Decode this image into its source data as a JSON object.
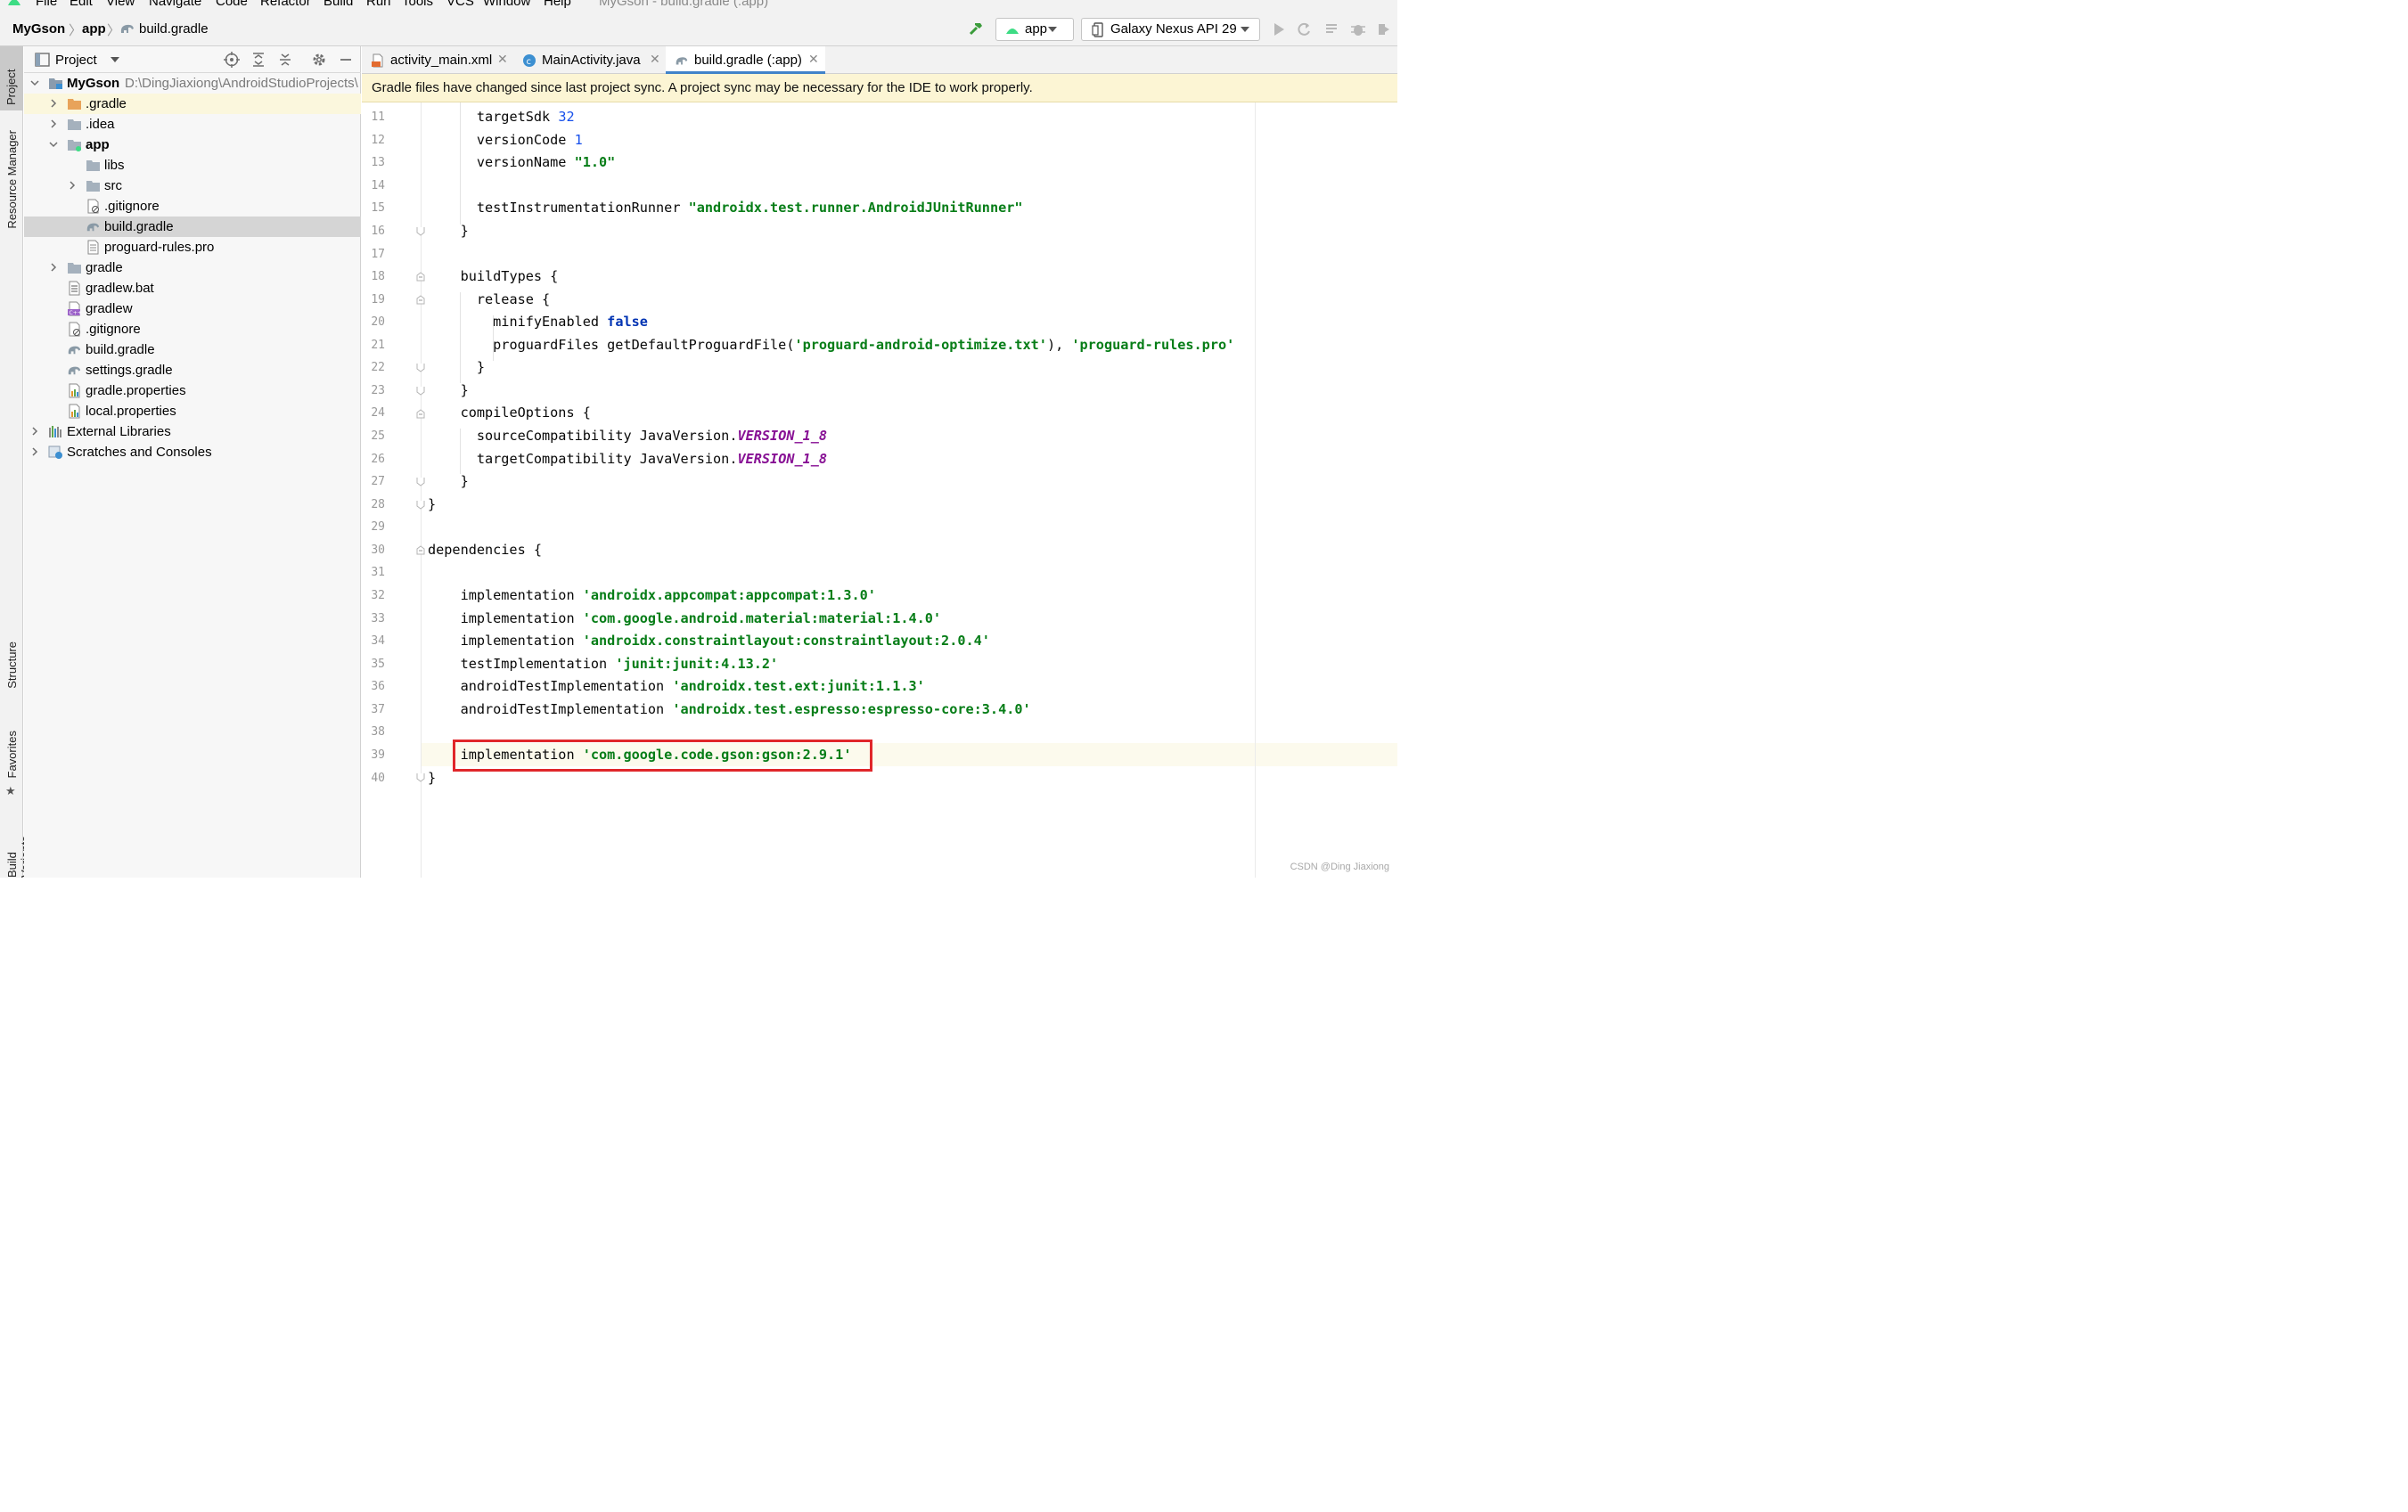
{
  "menu": {
    "items": [
      "File",
      "Edit",
      "View",
      "Navigate",
      "Code",
      "Refactor",
      "Build",
      "Run",
      "Tools",
      "VCS",
      "Window",
      "Help"
    ],
    "window_title": "MyGson - build.gradle (:app)"
  },
  "breadcrumb": {
    "project": "MyGson",
    "module": "app",
    "file": "build.gradle"
  },
  "toolbar": {
    "run_config": "app",
    "device": "Galaxy Nexus API 29"
  },
  "left_strip": {
    "tabs": [
      "Project",
      "Resource Manager",
      "Structure",
      "Favorites",
      "Build Variants"
    ]
  },
  "project_panel": {
    "title": "Project",
    "root": {
      "name": "MyGson",
      "path": "D:\\DingJiaxiong\\AndroidStudioProjects\\"
    },
    "items": [
      {
        "label": ".gradle",
        "icon": "folder-orange-icon"
      },
      {
        "label": ".idea",
        "icon": "folder-icon"
      },
      {
        "label": "app",
        "icon": "module-folder-icon"
      },
      {
        "label": "libs",
        "icon": "folder-icon"
      },
      {
        "label": "src",
        "icon": "folder-icon"
      },
      {
        "label": ".gitignore",
        "icon": "gitignore-file-icon"
      },
      {
        "label": "build.gradle",
        "icon": "gradle-elephant-icon"
      },
      {
        "label": "proguard-rules.pro",
        "icon": "text-file-icon"
      },
      {
        "label": "gradle",
        "icon": "folder-icon"
      },
      {
        "label": "gradlew.bat",
        "icon": "bat-file-icon"
      },
      {
        "label": "gradlew",
        "icon": "script-file-icon"
      },
      {
        "label": ".gitignore",
        "icon": "gitignore-file-icon"
      },
      {
        "label": "build.gradle",
        "icon": "gradle-elephant-icon"
      },
      {
        "label": "settings.gradle",
        "icon": "gradle-elephant-icon"
      },
      {
        "label": "gradle.properties",
        "icon": "properties-file-icon"
      },
      {
        "label": "local.properties",
        "icon": "properties-file-icon"
      },
      {
        "label": "External Libraries",
        "icon": "libraries-icon"
      },
      {
        "label": "Scratches and Consoles",
        "icon": "scratches-icon"
      }
    ]
  },
  "tabs": [
    {
      "label": "activity_main.xml",
      "icon": "xml-file-icon"
    },
    {
      "label": "MainActivity.java",
      "icon": "java-class-icon"
    },
    {
      "label": "build.gradle (:app)",
      "icon": "gradle-elephant-icon"
    }
  ],
  "notification": "Gradle files have changed since last project sync. A project sync may be necessary for the IDE to work properly.",
  "editor": {
    "line_numbers": [
      "11",
      "12",
      "13",
      "14",
      "15",
      "16",
      "17",
      "18",
      "19",
      "20",
      "21",
      "22",
      "23",
      "24",
      "25",
      "26",
      "27",
      "28",
      "29",
      "30",
      "31",
      "32",
      "33",
      "34",
      "35",
      "36",
      "37",
      "38",
      "39",
      "40"
    ],
    "code": {
      "l11": [
        "targetSdk ",
        "32"
      ],
      "l12": [
        "versionCode ",
        "1"
      ],
      "l13": [
        "versionName ",
        "\"1.0\""
      ],
      "l15": [
        "testInstrumentationRunner ",
        "\"androidx.test.runner.AndroidJUnitRunner\""
      ],
      "l16": "}",
      "l18": "buildTypes {",
      "l19": "release {",
      "l20": [
        "minifyEnabled ",
        "false"
      ],
      "l21": [
        "proguardFiles getDefaultProguardFile(",
        "'proguard-android-optimize.txt'",
        "), ",
        "'proguard-rules.pro'"
      ],
      "l22": "}",
      "l23": "}",
      "l24": "compileOptions {",
      "l25": [
        "sourceCompatibility JavaVersion.",
        "VERSION_1_8"
      ],
      "l26": [
        "targetCompatibility JavaVersion.",
        "VERSION_1_8"
      ],
      "l27": "}",
      "l28": "}",
      "l30": "dependencies {",
      "l32": [
        "implementation ",
        "'androidx.appcompat:appcompat:1.3.0'"
      ],
      "l33": [
        "implementation ",
        "'com.google.android.material:material:1.4.0'"
      ],
      "l34": [
        "implementation ",
        "'androidx.constraintlayout:constraintlayout:2.0.4'"
      ],
      "l35": [
        "testImplementation ",
        "'junit:junit:4.13.2'"
      ],
      "l36": [
        "androidTestImplementation ",
        "'androidx.test.ext:junit:1.1.3'"
      ],
      "l37": [
        "androidTestImplementation ",
        "'androidx.test.espresso:espresso-core:3.4.0'"
      ],
      "l39": [
        "implementation ",
        "'com.google.code.gson:gson:2.9.1'"
      ],
      "l40": "}"
    }
  },
  "watermark": "CSDN @Ding Jiaxiong",
  "colors": {
    "string": "#067d17",
    "number": "#1750eb",
    "keyword": "#0033b3",
    "constant": "#871094",
    "highlight_box": "#e0262a",
    "accent_tab": "#4083c9"
  }
}
